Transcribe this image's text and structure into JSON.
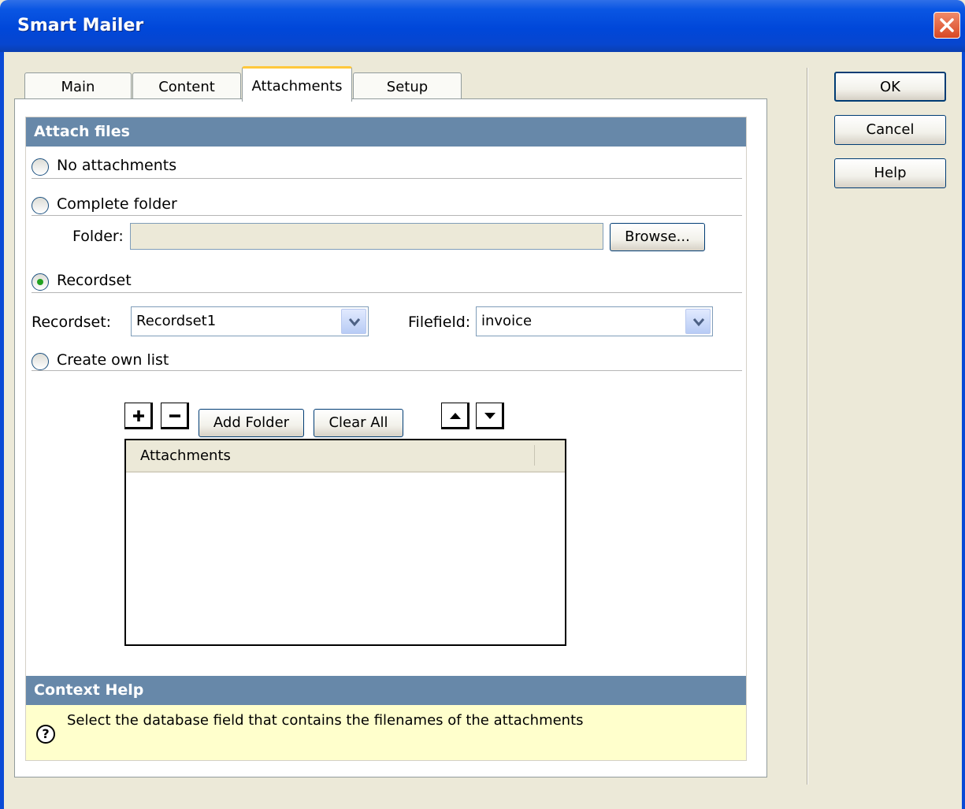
{
  "window": {
    "title": "Smart Mailer"
  },
  "tabs": [
    {
      "label": "Main"
    },
    {
      "label": "Content"
    },
    {
      "label": "Attachments",
      "active": true
    },
    {
      "label": "Setup"
    }
  ],
  "dialog_buttons": {
    "ok": "OK",
    "cancel": "Cancel",
    "help": "Help"
  },
  "attach_section": {
    "header": "Attach files",
    "options": {
      "none": "No attachments",
      "folder": "Complete folder",
      "recordset": "Recordset",
      "own_list": "Create own list"
    },
    "selected": "recordset",
    "folder_label": "Folder:",
    "folder_value": "",
    "browse_label": "Browse...",
    "recordset_label": "Recordset:",
    "recordset_value": "Recordset1",
    "filefield_label": "Filefield:",
    "filefield_value": "invoice",
    "add_folder_label": "Add Folder",
    "clear_all_label": "Clear All",
    "list_column": "Attachments",
    "list_items": []
  },
  "context_help": {
    "header": "Context Help",
    "text": "Select the database field that contains the filenames of the attachments"
  },
  "colors": {
    "title_bar": "#0047d9",
    "section_header": "#6788a9",
    "help_bg": "#ffffcc",
    "active_tab_accent": "#ffc83c"
  },
  "icons": [
    "close-icon",
    "plus-icon",
    "minus-icon",
    "arrow-up-icon",
    "arrow-down-icon",
    "chevron-down-icon",
    "help-question-icon"
  ]
}
